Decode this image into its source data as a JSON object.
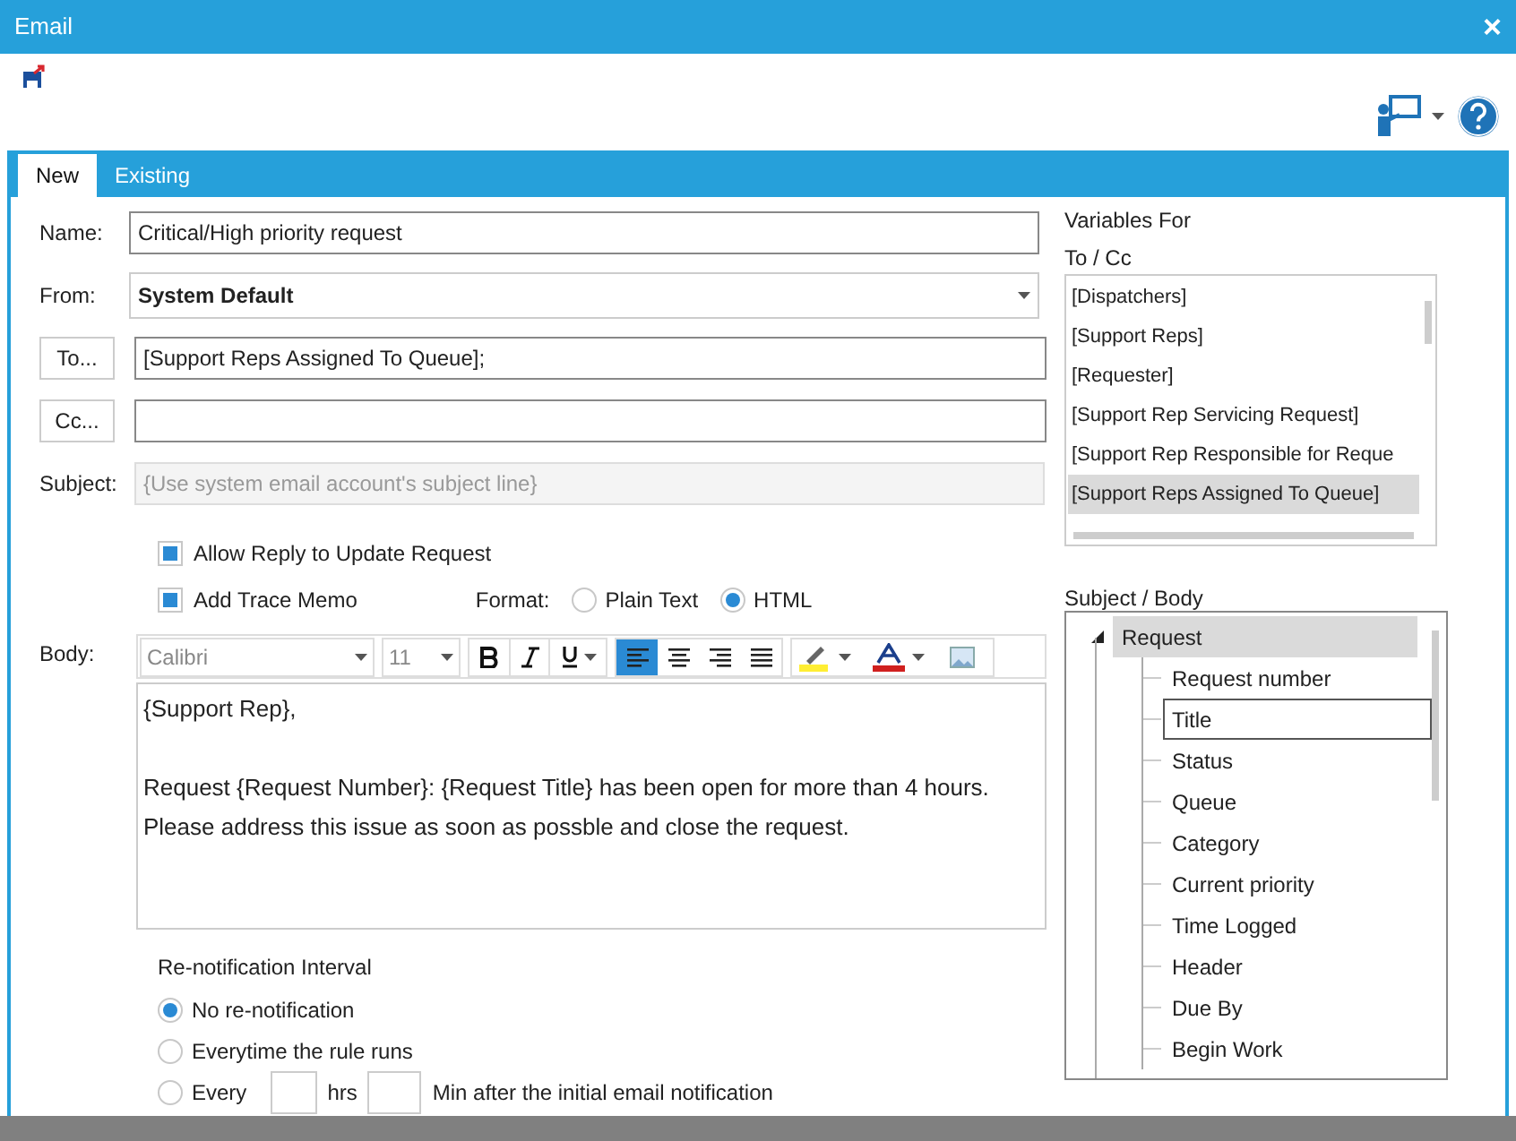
{
  "window": {
    "title": "Email",
    "close": "×"
  },
  "tabs": [
    {
      "label": "New",
      "selected": true
    },
    {
      "label": "Existing",
      "selected": false
    }
  ],
  "form": {
    "name_label": "Name:",
    "name_value": "Critical/High priority request",
    "from_label": "From:",
    "from_value": "System Default",
    "to_button": "To...",
    "to_value": "[Support Reps Assigned To Queue];",
    "cc_button": "Cc...",
    "subject_label": "Subject:",
    "subject_placeholder": "{Use system email account's subject line}",
    "options": [
      {
        "label": "Allow Reply to Update Request",
        "checked": true
      },
      {
        "label": "Add Trace Memo",
        "checked": true
      }
    ],
    "format_label": "Format:",
    "formats": [
      {
        "label": "Plain Text",
        "selected": false
      },
      {
        "label": "HTML",
        "selected": true
      }
    ],
    "body_label": "Body:",
    "font": "Calibri",
    "size": "11",
    "align": [
      {
        "selected": true
      },
      {
        "selected": false
      },
      {
        "selected": false
      },
      {
        "selected": false
      }
    ],
    "body_paragraphs": [
      [
        "{Support Rep},"
      ],
      [
        "Request {Request Number}: {Request Title} has been open for more than 4 hours.",
        "Please address this issue as soon as possble and close the request."
      ]
    ],
    "renotify_label": "Re-notification Interval",
    "renotify": [
      {
        "label": "No re-notification",
        "selected": true
      },
      {
        "label": "Everytime the rule runs",
        "selected": false
      },
      {
        "label": "Every",
        "selected": false
      }
    ],
    "hrs": "hrs",
    "min_text": "Min after the initial email notification"
  },
  "variables": {
    "title_1": "Variables For",
    "title_2": "To / Cc",
    "items": [
      {
        "label": "[Dispatchers]",
        "selected": false
      },
      {
        "label": "[Support Reps]",
        "selected": false
      },
      {
        "label": "[Requester]",
        "selected": false
      },
      {
        "label": "[Support Rep Servicing Request]",
        "selected": false
      },
      {
        "label": "[Support Rep Responsible for Reque",
        "selected": false
      },
      {
        "label": "[Support Reps Assigned To Queue]",
        "selected": true
      }
    ]
  },
  "subject_body": {
    "title": "Subject / Body",
    "tree": [
      {
        "label": "Request",
        "expanded": true,
        "selected": true,
        "children": [
          {
            "label": "Request number",
            "focused": false
          },
          {
            "label": "Title",
            "focused": true
          },
          {
            "label": "Status",
            "focused": false
          },
          {
            "label": "Queue",
            "focused": false
          },
          {
            "label": "Category",
            "focused": false
          },
          {
            "label": "Current priority",
            "focused": false
          },
          {
            "label": "Time Logged",
            "focused": false
          },
          {
            "label": "Header",
            "focused": false
          },
          {
            "label": "Due By",
            "focused": false
          },
          {
            "label": "Begin Work",
            "focused": false
          }
        ]
      }
    ]
  }
}
